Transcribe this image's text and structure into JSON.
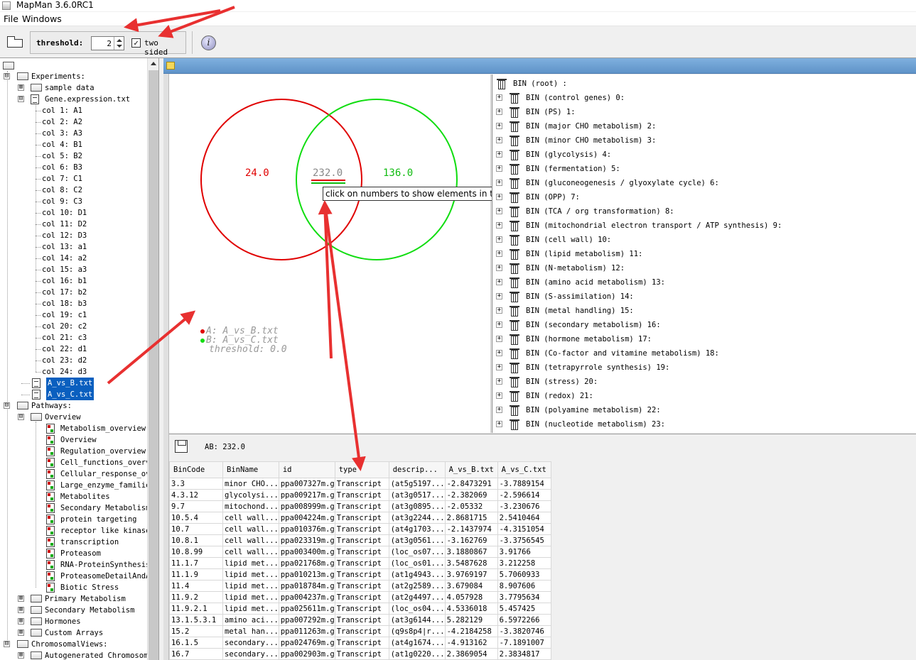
{
  "window": {
    "title": "MapMan 3.6.0RC1"
  },
  "menu": {
    "file": "File",
    "windows": "Windows"
  },
  "toolbar": {
    "threshold_label": "threshold:",
    "threshold_value": "2",
    "two_sided_label": "two sided",
    "two_sided_checked": true,
    "two_sided_mark": "✓",
    "info_glyph": "i"
  },
  "tree": {
    "experiments_label": "Experiments:",
    "sample_data": "sample data",
    "gene_expression": "Gene.expression.txt",
    "columns": [
      "col 1: A1",
      "col 2: A2",
      "col 3: A3",
      "col 4: B1",
      "col 5: B2",
      "col 6: B3",
      "col 7: C1",
      "col 8: C2",
      "col 9: C3",
      "col 10: D1",
      "col 11: D2",
      "col 12: D3",
      "col 13: a1",
      "col 14: a2",
      "col 15: a3",
      "col 16: b1",
      "col 17: b2",
      "col 18: b3",
      "col 19: c1",
      "col 20: c2",
      "col 21: c3",
      "col 22: d1",
      "col 23: d2",
      "col 24: d3"
    ],
    "selected_files": [
      "A_vs_B.txt",
      "A_vs_C.txt"
    ],
    "pathways_label": "Pathways:",
    "overview_label": "Overview",
    "overview_items": [
      "Metabolism_overview",
      "Overview",
      "Regulation_overview",
      "Cell_functions_overv",
      "Cellular_response_ov",
      "Large_enzyme_familie",
      "Metabolites",
      "Secondary Metabolism",
      "protein targeting",
      "receptor like kinase",
      "transcription",
      "Proteasom",
      "RNA-ProteinSynthesis",
      "ProteasomeDetailAndA",
      "Biotic Stress"
    ],
    "pathway_folders": [
      "Primary Metabolism",
      "Secondary Metabolism",
      "Hormones",
      "Custom Arrays"
    ],
    "chromosomal_label": "ChromosomalViews:",
    "autogenerated_label": "Autogenerated Chromosom"
  },
  "venn": {
    "a_only": "24.0",
    "ab": "232.0",
    "b_only": "136.0",
    "tooltip": "click on numbers to show elements in table",
    "legend_a": "A: A_vs_B.txt",
    "legend_b": "B: A_vs_C.txt",
    "legend_threshold": "threshold: 0.0",
    "colors": {
      "a": "#e00000",
      "b": "#11dd11"
    }
  },
  "bins": [
    "BIN (root) :",
    "BIN (control genes) 0:",
    "BIN (PS) 1:",
    "BIN (major CHO metabolism) 2:",
    "BIN (minor CHO metabolism) 3:",
    "BIN (glycolysis) 4:",
    "BIN (fermentation) 5:",
    "BIN (gluconeogenesis / glyoxylate cycle) 6:",
    "BIN (OPP) 7:",
    "BIN (TCA / org transformation) 8:",
    "BIN (mitochondrial electron transport / ATP synthesis) 9:",
    "BIN (cell wall) 10:",
    "BIN (lipid metabolism) 11:",
    "BIN (N-metabolism) 12:",
    "BIN (amino acid metabolism) 13:",
    "BIN (S-assimilation) 14:",
    "BIN (metal handling) 15:",
    "BIN (secondary metabolism) 16:",
    "BIN (hormone metabolism) 17:",
    "BIN (Co-factor and vitamine metabolism) 18:",
    "BIN (tetrapyrrole synthesis) 19:",
    "BIN (stress) 20:",
    "BIN (redox) 21:",
    "BIN (polyamine metabolism) 22:",
    "BIN (nucleotide metabolism) 23:"
  ],
  "table": {
    "ab_label": "AB: 232.0",
    "columns": [
      "BinCode",
      "BinName",
      "id",
      "type",
      "descrip...",
      "A_vs_B.txt",
      "A_vs_C.txt"
    ],
    "rows": [
      [
        "3.3",
        "minor CHO...",
        "ppa007327m.g",
        "Transcript",
        "(at5g5197...",
        "-2.8473291",
        "-3.7889154"
      ],
      [
        "4.3.12",
        "glycolysi...",
        "ppa009217m.g",
        "Transcript",
        "(at3g0517...",
        "-2.382069",
        "-2.596614"
      ],
      [
        "9.7",
        "mitochond...",
        "ppa008999m.g",
        "Transcript",
        "(at3g0895...",
        "-2.05332",
        "-3.230676"
      ],
      [
        "10.5.4",
        "cell wall...",
        "ppa004224m.g",
        "Transcript",
        "(at3g2244...",
        "2.8681715",
        "2.5410464"
      ],
      [
        "10.7",
        "cell wall...",
        "ppa010376m.g",
        "Transcript",
        "(at4g1703...",
        "-2.1437974",
        "-4.3151054"
      ],
      [
        "10.8.1",
        "cell wall...",
        "ppa023319m.g",
        "Transcript",
        "(at3g0561...",
        "-3.162769",
        "-3.3756545"
      ],
      [
        "10.8.99",
        "cell wall...",
        "ppa003400m.g",
        "Transcript",
        "(loc_os07...",
        "3.1880867",
        "3.91766"
      ],
      [
        "11.1.7",
        "lipid met...",
        "ppa021768m.g",
        "Transcript",
        "(loc_os01...",
        "3.5487628",
        "3.212258"
      ],
      [
        "11.1.9",
        "lipid met...",
        "ppa010213m.g",
        "Transcript",
        "(at1g4943...",
        "3.9769197",
        "5.7060933"
      ],
      [
        "11.4",
        "lipid met...",
        "ppa018784m.g",
        "Transcript",
        "(at2g2589...",
        "3.679084",
        "8.907606"
      ],
      [
        "11.9.2",
        "lipid met...",
        "ppa004237m.g",
        "Transcript",
        "(at2g4497...",
        "4.057928",
        "3.7795634"
      ],
      [
        "11.9.2.1",
        "lipid met...",
        "ppa025611m.g",
        "Transcript",
        "(loc_os04...",
        "4.5336018",
        "5.457425"
      ],
      [
        "13.1.5.3.1",
        "amino aci...",
        "ppa007292m.g",
        "Transcript",
        "(at3g6144...",
        "5.282129",
        "6.5972266"
      ],
      [
        "15.2",
        "metal han...",
        "ppa011263m.g",
        "Transcript",
        "(q9s8p4|r...",
        "-4.2184258",
        "-3.3820746"
      ],
      [
        "16.1.5",
        "secondary...",
        "ppa024769m.g",
        "Transcript",
        "(at4g1674...",
        "-4.913162",
        "-7.1891007"
      ],
      [
        "16.7",
        "secondary...",
        "ppa002903m.g",
        "Transcript",
        "(at1g0220...",
        "2.3869054",
        "2.3834817"
      ]
    ]
  }
}
